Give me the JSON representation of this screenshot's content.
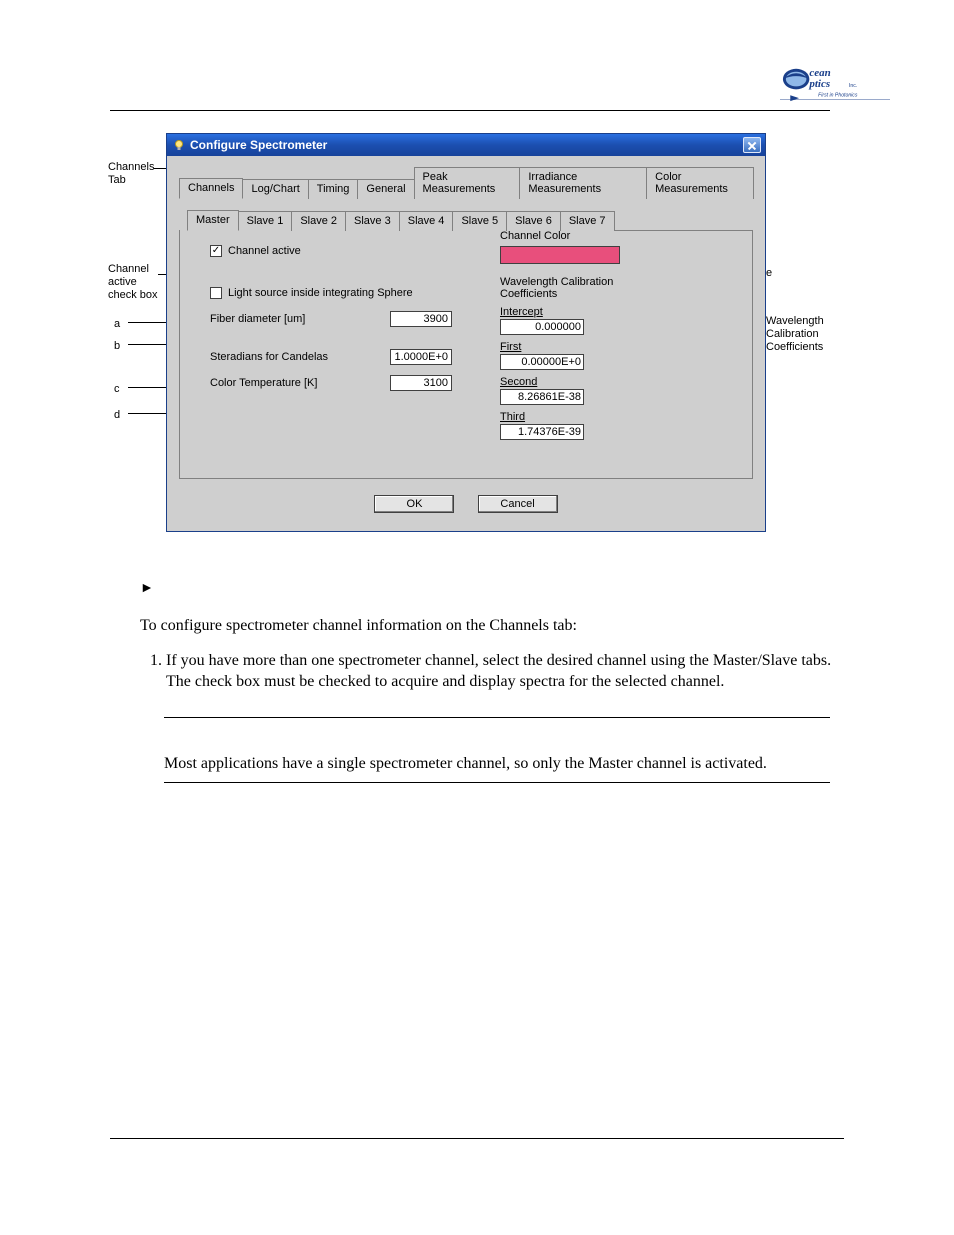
{
  "logo": {
    "line1": "cean",
    "line2": "ptics",
    "suffix": "Inc.",
    "tagline": "First in Photonics"
  },
  "callouts": {
    "channels_tab": "Channels\nTab",
    "channel_active": "Channel\nactive\ncheck box",
    "a": "a",
    "b": "b",
    "c": "c",
    "d": "d",
    "e": "e",
    "wavelength": "Wavelength\nCalibration\nCoefficients"
  },
  "dialog": {
    "title": "Configure Spectrometer",
    "tabs": [
      "Channels",
      "Log/Chart",
      "Timing",
      "General",
      "Peak Measurements",
      "Irradiance Measurements",
      "Color Measurements"
    ],
    "subtabs": [
      "Master",
      "Slave 1",
      "Slave 2",
      "Slave 3",
      "Slave 4",
      "Slave 5",
      "Slave 6",
      "Slave 7"
    ],
    "channel_active_label": "Channel active",
    "light_source_label": "Light source inside integrating Sphere",
    "fiber_label": "Fiber diameter [um]",
    "fiber_value": "3900",
    "steradians_label": "Steradians for Candelas",
    "steradians_value": "1.0000E+0",
    "colortemp_label": "Color Temperature [K]",
    "colortemp_value": "3100",
    "channel_color_title": "Channel Color",
    "wavelength_title": "Wavelength Calibration\nCoefficients",
    "coef": {
      "intercept_label": "Intercept",
      "intercept_value": "0.000000",
      "first_label": "First",
      "first_value": "0.00000E+0",
      "second_label": "Second",
      "second_value": "8.26861E-38",
      "third_label": "Third",
      "third_value": "1.74376E-39"
    },
    "ok": "OK",
    "cancel": "Cancel"
  },
  "body": {
    "procedure_mark": "►",
    "intro": "To configure spectrometer channel information on the Channels tab:",
    "step1_a": "If you have more than one spectrometer channel, select the desired channel using the Master/Slave tabs. The ",
    "step1_b": " check box must be checked to acquire and display spectra for the selected channel.",
    "note": "Most applications have a single spectrometer channel, so only the Master channel is activated."
  }
}
